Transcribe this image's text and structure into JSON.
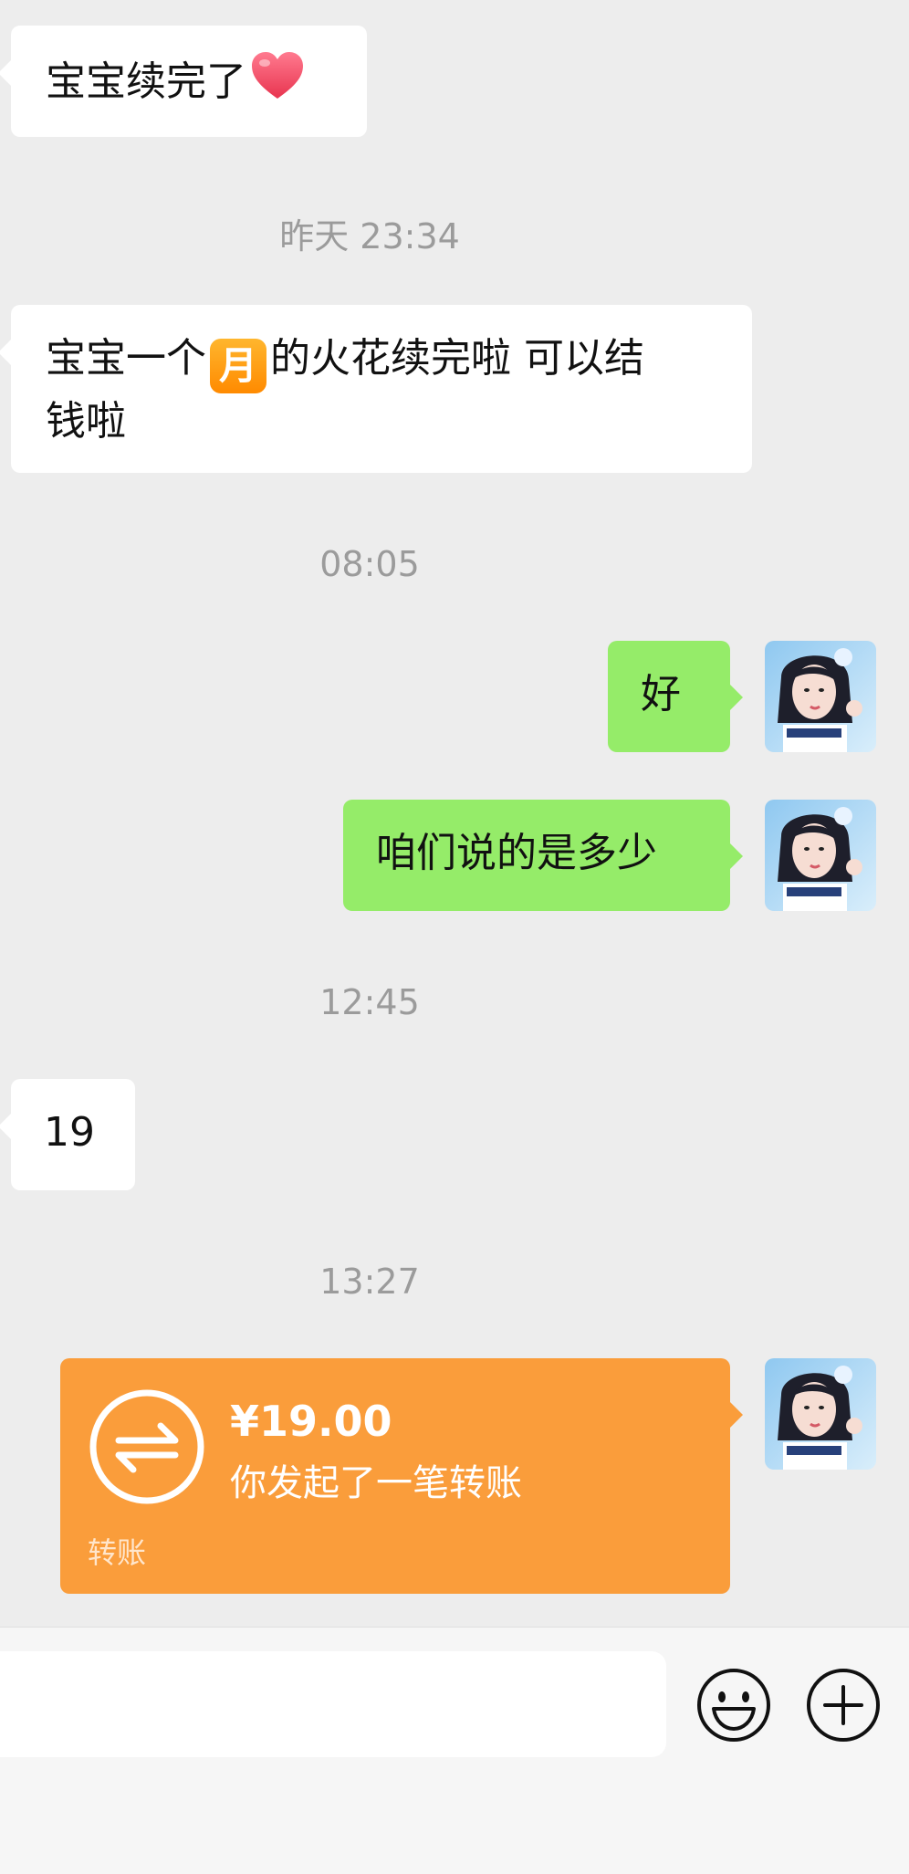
{
  "messages": [
    {
      "side": "in",
      "text": "宝宝续完了",
      "emoji": "heart"
    },
    {
      "timestamp": "昨天 23:34"
    },
    {
      "side": "in",
      "text_before_badge": "宝宝一个",
      "badge": "月",
      "text_after_badge_line1": "的火花续完啦 可以结",
      "text_line2": "钱啦"
    },
    {
      "timestamp": "08:05"
    },
    {
      "side": "out",
      "text": "好"
    },
    {
      "side": "out",
      "text": "咱们说的是多少"
    },
    {
      "timestamp": "12:45"
    },
    {
      "side": "in",
      "text": "19"
    },
    {
      "timestamp": "13:27"
    },
    {
      "side": "out",
      "type": "transfer",
      "amount": "¥19.00",
      "description": "你发起了一笔转账",
      "label": "转账",
      "icon": "transfer-arrows-icon"
    }
  ],
  "colors": {
    "background": "#ededed",
    "incoming_bubble": "#ffffff",
    "outgoing_bubble": "#95ec69",
    "transfer_card": "#fa9d3b",
    "timestamp_text": "#9b9b9b"
  },
  "bottom_bar": {
    "input_value": "",
    "emoji_icon": "smiley-icon",
    "more_icon": "plus-circle-icon"
  },
  "avatar": {
    "icon": "user-avatar"
  }
}
